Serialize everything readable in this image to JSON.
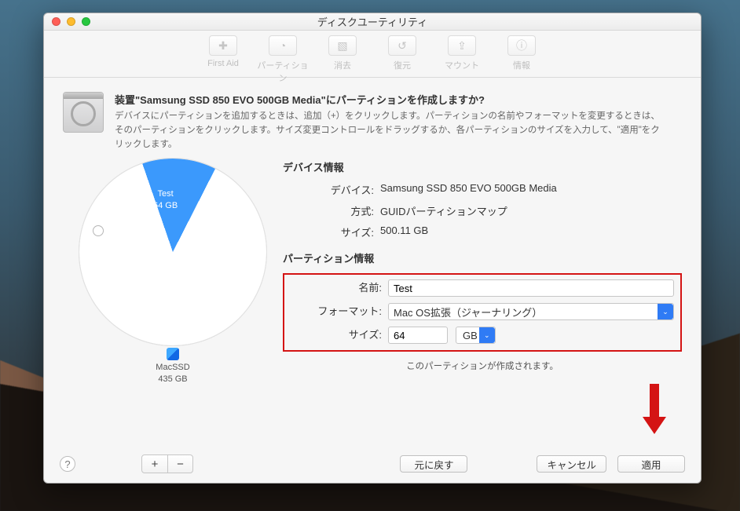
{
  "window": {
    "title": "ディスクユーティリティ"
  },
  "toolbar": {
    "items": [
      {
        "label": "First Aid",
        "icon": "stethoscope"
      },
      {
        "label": "パーティション",
        "icon": "pie"
      },
      {
        "label": "消去",
        "icon": "erase"
      },
      {
        "label": "復元",
        "icon": "restore"
      },
      {
        "label": "マウント",
        "icon": "mount"
      },
      {
        "label": "情報",
        "icon": "info"
      }
    ]
  },
  "header": {
    "title_prefix": "装置\"",
    "device_name": "Samsung SSD 850 EVO 500GB Media",
    "title_suffix": "\"にパーティションを作成しますか?",
    "description": "デバイスにパーティションを追加するときは、追加（+）をクリックします。パーティションの名前やフォーマットを変更するときは、そのパーティションをクリックします。サイズ変更コントロールをドラッグするか、各パーティションのサイズを入力して、\"適用\"をクリックします。"
  },
  "chart_data": {
    "type": "pie",
    "title": "",
    "units": "GB",
    "total": 500.11,
    "slices": [
      {
        "name": "Test",
        "value": 64,
        "color": "#3b99fc"
      },
      {
        "name": "MacSSD",
        "value": 435,
        "color": "#ffffff"
      }
    ],
    "slice_labels": {
      "test_name": "Test",
      "test_size": "64 GB",
      "macssd_name": "MacSSD",
      "macssd_size": "435 GB"
    }
  },
  "device_info": {
    "section_label": "デバイス情報",
    "device_label": "デバイス:",
    "device_value": "Samsung SSD 850 EVO 500GB Media",
    "scheme_label": "方式:",
    "scheme_value": "GUIDパーティションマップ",
    "size_label": "サイズ:",
    "size_value": "500.11 GB"
  },
  "partition_info": {
    "section_label": "パーティション情報",
    "name_label": "名前:",
    "name_value": "Test",
    "format_label": "フォーマット:",
    "format_value": "Mac OS拡張（ジャーナリング）",
    "size_label": "サイズ:",
    "size_value": "64",
    "size_unit": "GB",
    "hint": "このパーティションが作成されます。"
  },
  "footer": {
    "add": "+",
    "remove": "−",
    "revert": "元に戻す",
    "cancel": "キャンセル",
    "apply": "適用",
    "help": "?"
  }
}
